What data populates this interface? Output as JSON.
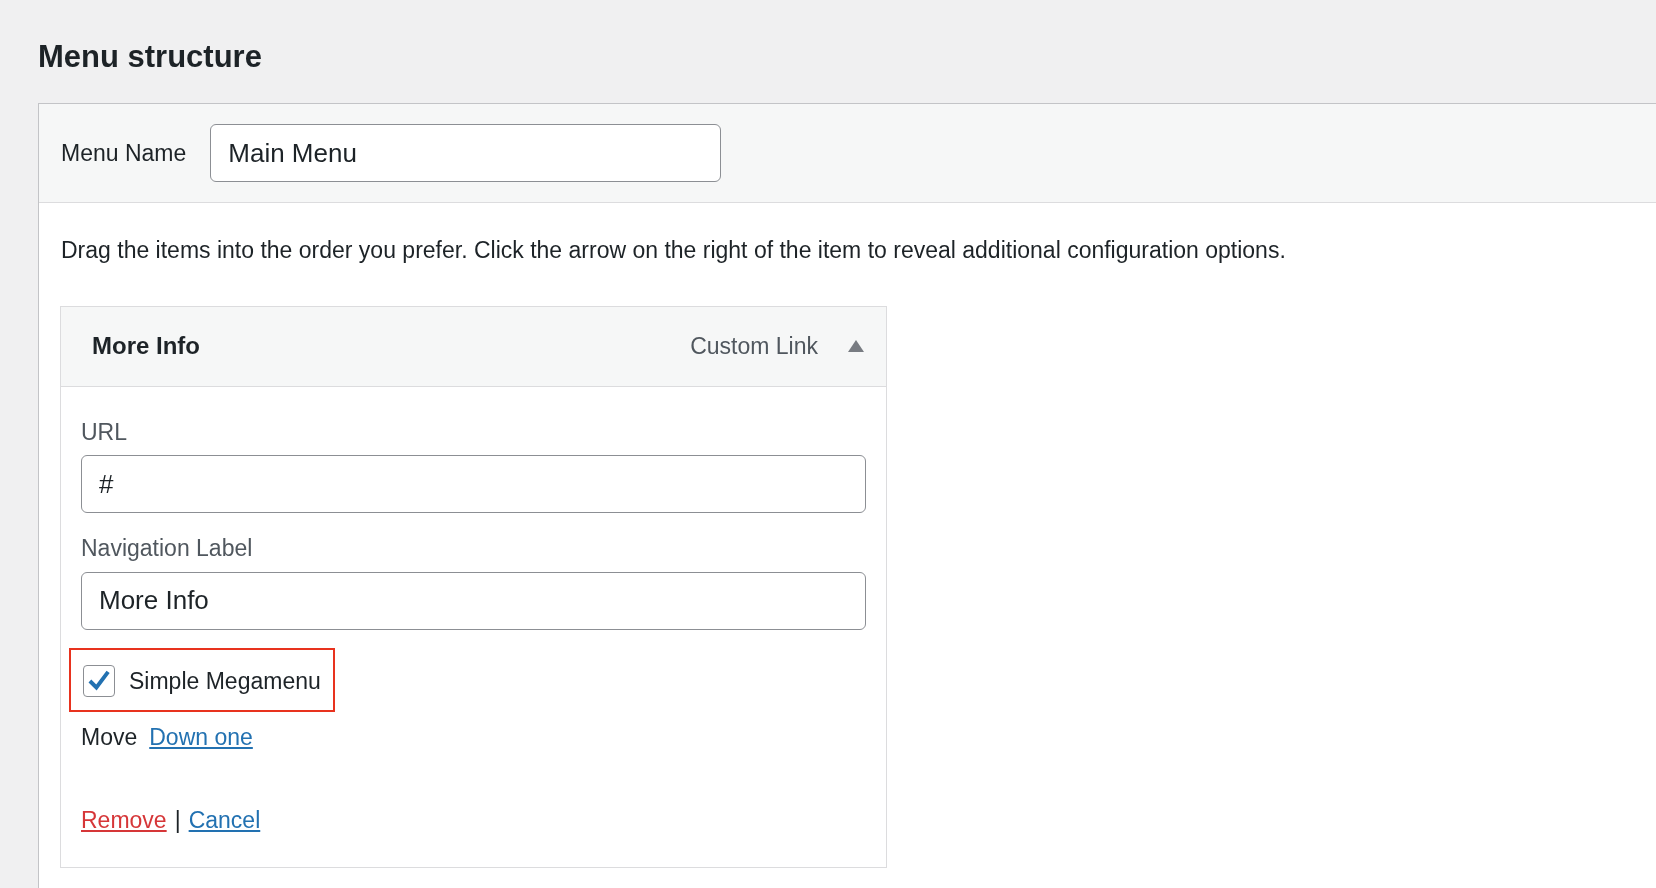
{
  "heading": "Menu structure",
  "menu_name": {
    "label": "Menu Name",
    "value": "Main Menu"
  },
  "instructions": "Drag the items into the order you prefer. Click the arrow on the right of the item to reveal additional configuration options.",
  "menu_item": {
    "title": "More Info",
    "type_label": "Custom Link",
    "expanded": true,
    "fields": [
      {
        "label": "URL",
        "value": "#"
      },
      {
        "label": "Navigation Label",
        "value": "More Info"
      }
    ],
    "option": {
      "label": "Simple Megamenu",
      "checked": true,
      "highlighted": true
    },
    "move": {
      "label": "Move",
      "link": "Down one"
    },
    "actions": [
      {
        "kind": "danger",
        "label": "Remove"
      },
      {
        "kind": "separator",
        "label": "|"
      },
      {
        "kind": "link",
        "label": "Cancel"
      }
    ]
  }
}
